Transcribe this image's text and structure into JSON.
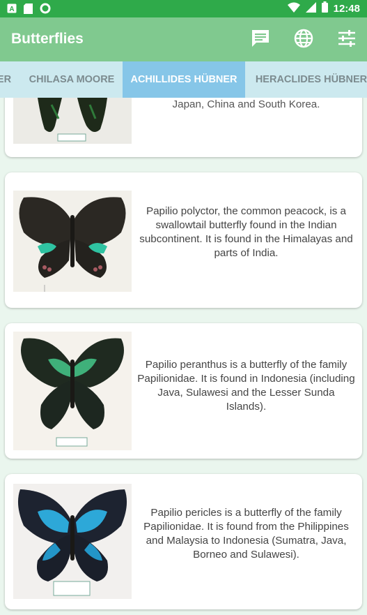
{
  "status_bar": {
    "time": "12:48",
    "left_icons": [
      "a-icon",
      "sd-card-icon",
      "circle-icon"
    ],
    "right_icons": [
      "wifi-icon",
      "signal-icon",
      "battery-icon"
    ]
  },
  "app_bar": {
    "title": "Butterflies",
    "actions": [
      "message-icon",
      "globe-icon",
      "tune-icon"
    ]
  },
  "tabs": [
    {
      "label": "ER"
    },
    {
      "label": "CHILASA MOORE"
    },
    {
      "label": "ACHILLIDES HÜBNER",
      "active": true
    },
    {
      "label": "HERACLIDES HÜBNER"
    }
  ],
  "cards": [
    {
      "description": "Japan, China and South Korea."
    },
    {
      "description": "Papilio polyctor, the common peacock, is a swallowtail butterfly found in the Indian subcontinent. It is found in the Himalayas and parts of India."
    },
    {
      "description": "Papilio peranthus is a butterfly of the family Papilionidae. It is found in Indonesia (including Java, Sulawesi and the Lesser Sunda Islands)."
    },
    {
      "description": "Papilio pericles is a butterfly of the family Papilionidae. It is found from the Philippines and Malaysia to Indonesia (Sumatra, Java, Borneo and Sulawesi)."
    }
  ],
  "specimen_labels": {
    "card2": "polyctor ganesa",
    "card4": "P. pericles"
  },
  "colors": {
    "status_bar": "#2faa4a",
    "app_bar": "#80c98f",
    "tab_strip": "#cce9ef",
    "tab_active": "#86c6e8",
    "background": "#eaf6ee"
  }
}
